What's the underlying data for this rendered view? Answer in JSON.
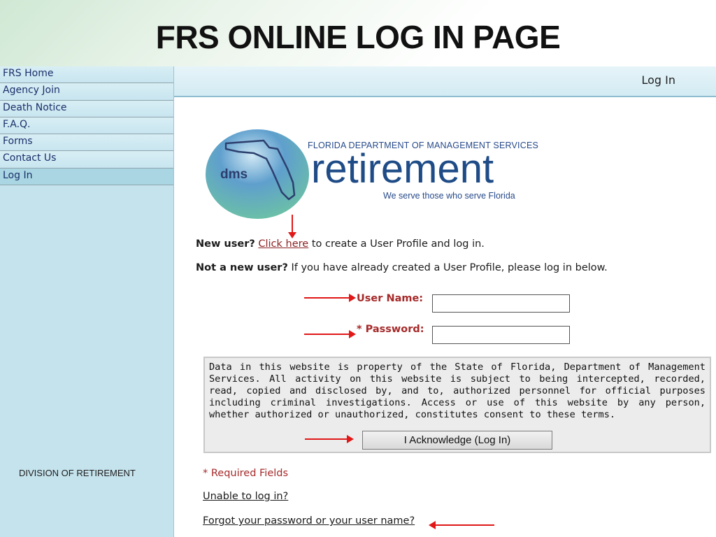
{
  "slide": {
    "title": "FRS ONLINE LOG IN PAGE",
    "footer_label": "DIVISION OF RETIREMENT"
  },
  "sidebar": {
    "items": [
      {
        "label": "FRS Home"
      },
      {
        "label": "Agency Join"
      },
      {
        "label": "Death Notice"
      },
      {
        "label": "F.A.Q."
      },
      {
        "label": "Forms"
      },
      {
        "label": "Contact Us"
      },
      {
        "label": "Log In",
        "active": true
      }
    ]
  },
  "header": {
    "title": "Log In"
  },
  "logo": {
    "badge_text": "dms",
    "agency": "FLORIDA DEPARTMENT OF MANAGEMENT SERVICES",
    "word": "retirement",
    "tagline": "We serve those who serve Florida"
  },
  "intro": {
    "new_user_prefix": "New user?",
    "new_user_link": "Click here",
    "new_user_suffix": "to create a User Profile and log in.",
    "existing_prefix": "Not a new user?",
    "existing_suffix": "If you have already created a User Profile, please log in below."
  },
  "form": {
    "username_label": "User Name:",
    "username_value": "",
    "password_label": "* Password:",
    "password_value": ""
  },
  "notice": {
    "text": "Data in this website is property of the State of Florida, Department of Management Services. All activity on this website is subject to being intercepted, recorded, read, copied and disclosed by, and to, authorized personnel for official purposes including criminal investigations. Access or use of this website by any person, whether authorized or unauthorized, constitutes consent to these terms.",
    "button_label": "I Acknowledge (Log In)"
  },
  "footer_links": {
    "required": "* Required Fields",
    "unable": "Unable to log in?",
    "forgot": "Forgot your password or your user name?"
  },
  "colors": {
    "arrow": "#e01818",
    "sidebar_bg": "#c5e3ed",
    "link": "#8b2323",
    "logo_blue": "#1f4c87"
  }
}
